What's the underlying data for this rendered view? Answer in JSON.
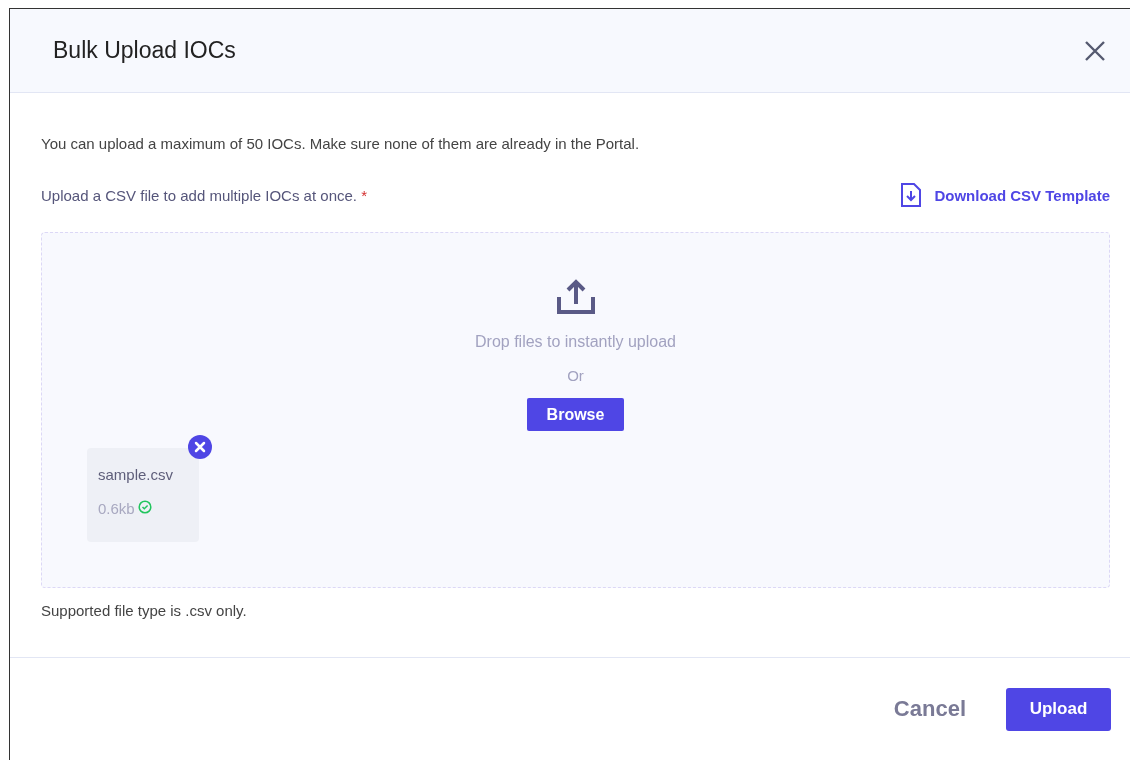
{
  "dialog": {
    "title": "Bulk Upload IOCs"
  },
  "intro": "You can upload a maximum of 50 IOCs. Make sure none of them are already in the Portal.",
  "upload_label": {
    "text": "Upload a CSV file to add multiple IOCs at once.",
    "required_mark": "*"
  },
  "template_link": "Download CSV Template",
  "dropzone": {
    "hint": "Drop files to instantly upload",
    "separator": "Or",
    "browse_button": "Browse"
  },
  "files": [
    {
      "name": "sample.csv",
      "size": "0.6kb",
      "uploaded": true
    }
  ],
  "note": "Supported file type is .csv only.",
  "buttons": [
    {
      "label": "Cancel",
      "kind": "secondary"
    },
    {
      "label": "Upload",
      "kind": "primary"
    }
  ]
}
